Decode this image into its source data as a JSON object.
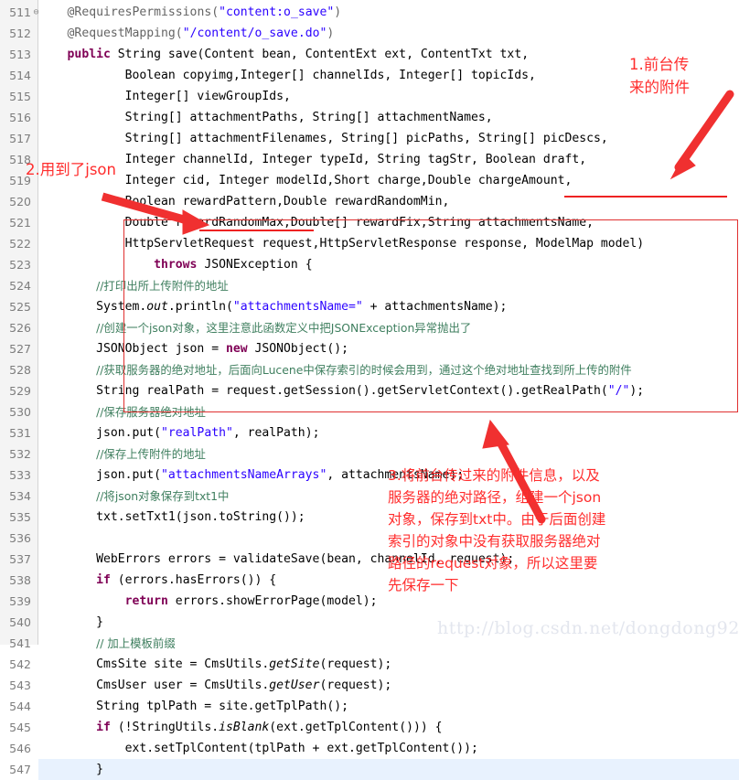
{
  "editor": {
    "first_line_number": 511,
    "line_count": 37,
    "current_line": 547,
    "fold_marker_line": 511,
    "fold_marker_glyph": "⊖",
    "colors": {
      "background": "#ffffff",
      "gutter_background": "#f4f4f4",
      "gutter_text": "#7d7d7d",
      "keyword": "#7f0055",
      "string": "#2a00ff",
      "annotation": "#646464",
      "comment": "#3f7f5f",
      "current_line_highlight": "#e8f2fe",
      "annotation_red": "#ff2d2d",
      "box_red": "#e03030"
    },
    "lines": [
      {
        "n": 511,
        "text": "    @RequiresPermissions(\"content:o_save\")"
      },
      {
        "n": 512,
        "text": "    @RequestMapping(\"/content/o_save.do\")"
      },
      {
        "n": 513,
        "text": "    public String save(Content bean, ContentExt ext, ContentTxt txt,"
      },
      {
        "n": 514,
        "text": "            Boolean copyimg,Integer[] channelIds, Integer[] topicIds,"
      },
      {
        "n": 515,
        "text": "            Integer[] viewGroupIds,"
      },
      {
        "n": 516,
        "text": "            String[] attachmentPaths, String[] attachmentNames,"
      },
      {
        "n": 517,
        "text": "            String[] attachmentFilenames, String[] picPaths, String[] picDescs,"
      },
      {
        "n": 518,
        "text": "            Integer channelId, Integer typeId, String tagStr, Boolean draft,"
      },
      {
        "n": 519,
        "text": "            Integer cid, Integer modelId,Short charge,Double chargeAmount,"
      },
      {
        "n": 520,
        "text": "            Boolean rewardPattern,Double rewardRandomMin,"
      },
      {
        "n": 521,
        "text": "            Double rewardRandomMax,Double[] rewardFix,String attachmentsName,"
      },
      {
        "n": 522,
        "text": "            HttpServletRequest request,HttpServletResponse response, ModelMap model)"
      },
      {
        "n": 523,
        "text": "                throws JSONException {"
      },
      {
        "n": 524,
        "text": "        //打印出所上传附件的地址"
      },
      {
        "n": 525,
        "text": "        System.out.println(\"attachmentsName=\" + attachmentsName);"
      },
      {
        "n": 526,
        "text": "        //创建一个json对象，这里注意此函数定义中把JSONException异常抛出了"
      },
      {
        "n": 527,
        "text": "        JSONObject json = new JSONObject();"
      },
      {
        "n": 528,
        "text": "        //获取服务器的绝对地址，后面向Lucene中保存索引的时候会用到，通过这个绝对地址查找到所上传的附件"
      },
      {
        "n": 529,
        "text": "        String realPath = request.getSession().getServletContext().getRealPath(\"/\");"
      },
      {
        "n": 530,
        "text": "        //保存服务器绝对地址"
      },
      {
        "n": 531,
        "text": "        json.put(\"realPath\", realPath);"
      },
      {
        "n": 532,
        "text": "        //保存上传附件的地址"
      },
      {
        "n": 533,
        "text": "        json.put(\"attachmentsNameArrays\", attachmentsName);"
      },
      {
        "n": 534,
        "text": "        //将json对象保存到txt1中"
      },
      {
        "n": 535,
        "text": "        txt.setTxt1(json.toString());"
      },
      {
        "n": 536,
        "text": ""
      },
      {
        "n": 537,
        "text": "        WebErrors errors = validateSave(bean, channelId, request);"
      },
      {
        "n": 538,
        "text": "        if (errors.hasErrors()) {"
      },
      {
        "n": 539,
        "text": "            return errors.showErrorPage(model);"
      },
      {
        "n": 540,
        "text": "        }"
      },
      {
        "n": 541,
        "text": "        // 加上模板前缀"
      },
      {
        "n": 542,
        "text": "        CmsSite site = CmsUtils.getSite(request);"
      },
      {
        "n": 543,
        "text": "        CmsUser user = CmsUtils.getUser(request);"
      },
      {
        "n": 544,
        "text": "        String tplPath = site.getTplPath();"
      },
      {
        "n": 545,
        "text": "        if (!StringUtils.isBlank(ext.getTplContent())) {"
      },
      {
        "n": 546,
        "text": "            ext.setTplContent(tplPath + ext.getTplContent());"
      },
      {
        "n": 547,
        "text": "        }"
      }
    ]
  },
  "annotations": [
    {
      "id": 1,
      "number": "1.",
      "text": "前台传\n来的附件",
      "full": "1.前台传来的附件"
    },
    {
      "id": 2,
      "number": "2.",
      "text": "用到了json",
      "full": "2.用到了json"
    },
    {
      "id": 3,
      "number": "3.",
      "text": "将前台传过来的附件信息，以及\n服务器的绝对路径，组建一个json\n对象，保存到txt中。由于后面创建\n索引的对象中没有获取服务器绝对\n路径的request对象，所以这里要\n先保存一下",
      "full": "3.将前台传过来的附件信息，以及服务器的绝对路径，组建一个json对象，保存到txt中。由于后面创建索引的对象中没有获取服务器绝对路径的request对象，所以这里要先保存一下"
    }
  ],
  "watermark": {
    "text": "http://blog.csdn.net/dongdong9223"
  }
}
